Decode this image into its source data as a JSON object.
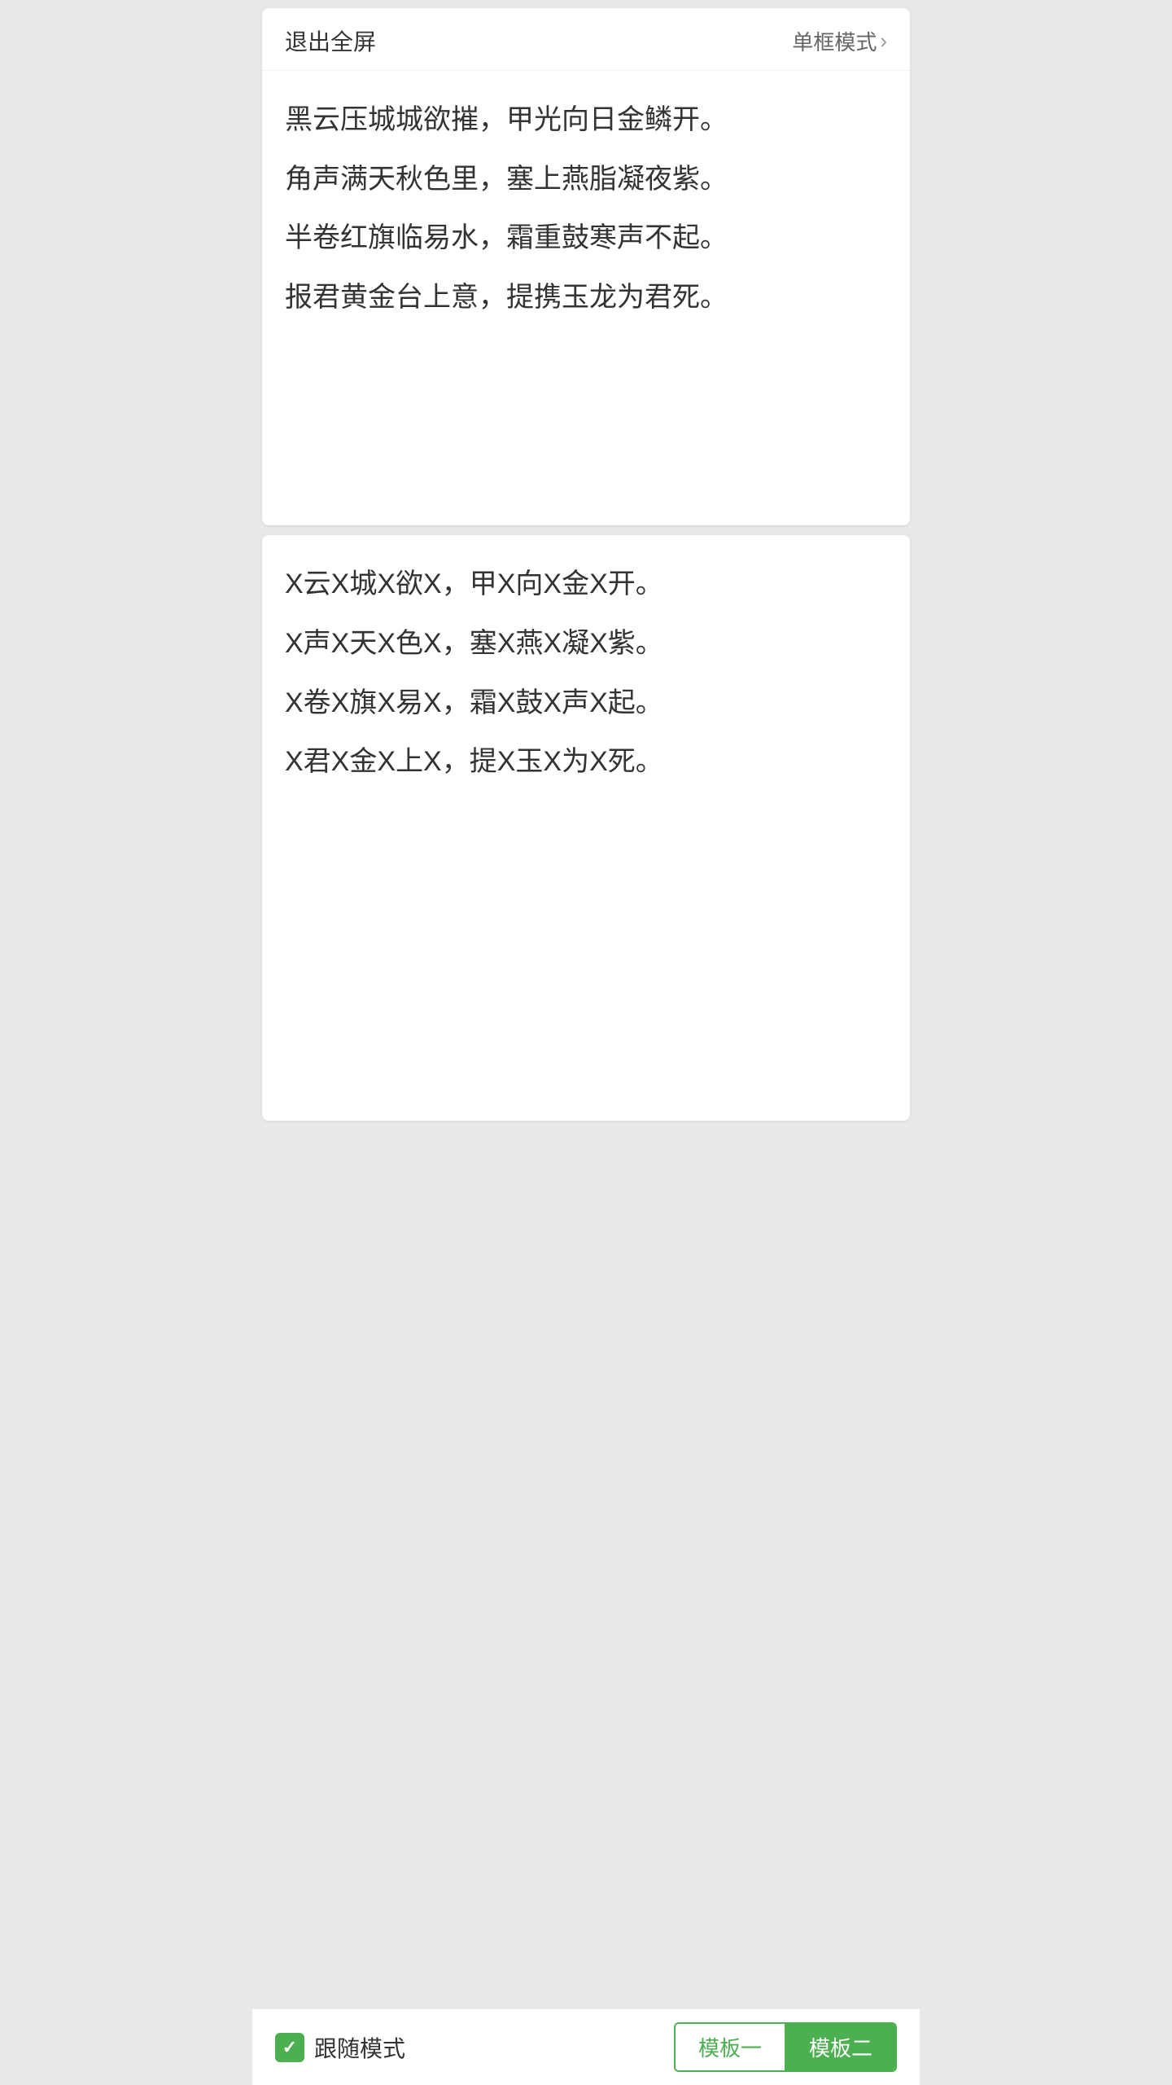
{
  "topCard": {
    "exitLabel": "退出全屏",
    "singleFrameLabel": "单框模式",
    "poems": [
      "黑云压城城欲摧，甲光向日金鳞开。",
      "角声满天秋色里，塞上燕脂凝夜紫。",
      "半卷红旗临易水，霜重鼓寒声不起。",
      "报君黄金台上意，提携玉龙为君死。"
    ]
  },
  "bottomCard": {
    "maskedPoems": [
      "X云X城X欲X，甲X向X金X开。",
      "X声X天X色X，塞X燕X凝X紫。",
      "X卷X旗X易X，霜X鼓X声X起。",
      "X君X金X上X，提X玉X为X死。"
    ]
  },
  "bottomBar": {
    "followModeLabel": "跟随模式",
    "templateOneLabel": "模板一",
    "templateTwoLabel": "模板二"
  }
}
